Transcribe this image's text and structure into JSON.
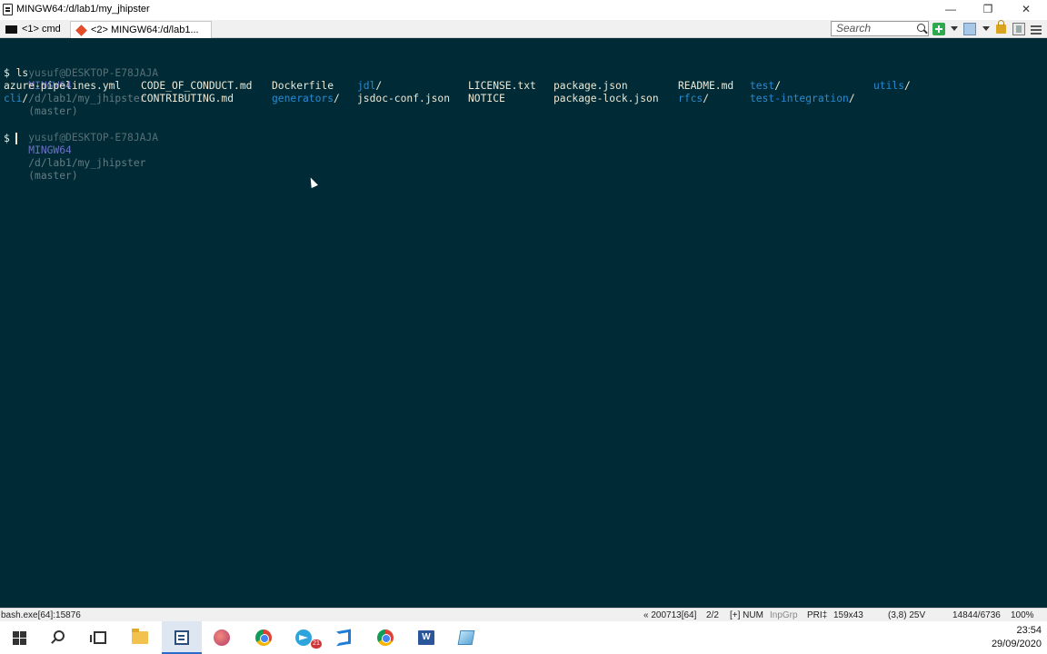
{
  "window": {
    "title": "MINGW64:/d/lab1/my_jhipster"
  },
  "tabs": [
    {
      "label": "<1> cmd"
    },
    {
      "label": "<2> MINGW64:/d/lab1..."
    }
  ],
  "toolbar": {
    "search_placeholder": "Search"
  },
  "terminal": {
    "prompt1": {
      "user": "yusuf@DESKTOP-E78JAJA",
      "system": "MINGW64",
      "path": "/d/lab1/my_jhipster",
      "branch": "(master)"
    },
    "command": "$ ls",
    "listing": [
      {
        "name": "azure-pipelines.yml",
        "is_dir": false
      },
      {
        "name": "CODE_OF_CONDUCT.md",
        "is_dir": false
      },
      {
        "name": "Dockerfile",
        "is_dir": false
      },
      {
        "name": "jdl",
        "is_dir": true
      },
      {
        "name": "LICENSE.txt",
        "is_dir": false
      },
      {
        "name": "package.json",
        "is_dir": false
      },
      {
        "name": "README.md",
        "is_dir": false
      },
      {
        "name": "test",
        "is_dir": true
      },
      {
        "name": "utils",
        "is_dir": true
      },
      {
        "name": "cli",
        "is_dir": true
      },
      {
        "name": "CONTRIBUTING.md",
        "is_dir": false
      },
      {
        "name": "generators",
        "is_dir": true
      },
      {
        "name": "jsdoc-conf.json",
        "is_dir": false
      },
      {
        "name": "NOTICE",
        "is_dir": false
      },
      {
        "name": "package-lock.json",
        "is_dir": false
      },
      {
        "name": "rfcs",
        "is_dir": true
      },
      {
        "name": "test-integration",
        "is_dir": true
      }
    ],
    "prompt2": {
      "user": "yusuf@DESKTOP-E78JAJA",
      "system": "MINGW64",
      "path": "/d/lab1/my_jhipster",
      "branch": "(master)"
    },
    "input_prompt": "$"
  },
  "statusbar": {
    "process": "bash.exe[64]:15876",
    "build": "« 200713[64]",
    "console_index": "2/2",
    "flags": "[+] NUM",
    "inpgrp": "InpGrp",
    "priority": "PRI‡",
    "size": "159x43",
    "cursor_pos": "(3,8) 25V",
    "buffer": "14844/6736",
    "zoom": "100%"
  },
  "taskbar": {
    "apps": [
      {
        "name": "file-explorer"
      },
      {
        "name": "conemu",
        "active": true
      },
      {
        "name": "paint-3d"
      },
      {
        "name": "chrome"
      },
      {
        "name": "telegram",
        "badge": "21"
      },
      {
        "name": "vscode"
      },
      {
        "name": "chrome"
      },
      {
        "name": "word"
      },
      {
        "name": "app"
      }
    ],
    "time": "23:54",
    "date": "29/09/2020"
  },
  "colors": {
    "terminal_bg": "#002b36",
    "terminal_fg": "#eee8d5",
    "prompt_user": "#586e75",
    "prompt_system": "#6c71c4",
    "directory": "#268bd2"
  }
}
